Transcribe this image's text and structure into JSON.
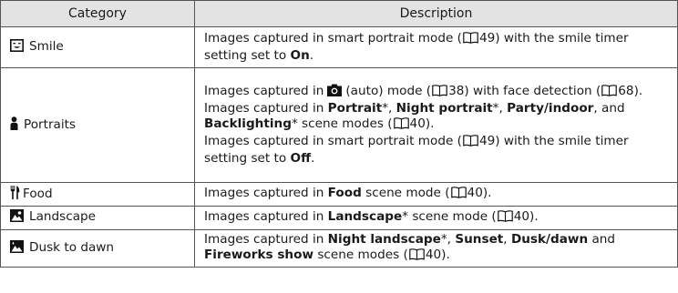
{
  "header": {
    "category": "Category",
    "description": "Description"
  },
  "rows": [
    {
      "icon": "smile-face-icon",
      "category": "Smile",
      "lines": [
        {
          "parts": [
            {
              "t": "Images captured in smart portrait mode ("
            },
            {
              "book": "49"
            },
            {
              "t": ") with the smile timer setting set to "
            },
            {
              "b": "On"
            },
            {
              "t": "."
            }
          ]
        }
      ]
    },
    {
      "icon": "person-icon",
      "category": "Portraits",
      "lines": [
        {
          "parts": [
            {
              "t": "Images captured in"
            },
            {
              "cam": "camera-icon"
            },
            {
              "t": "(auto) mode ("
            },
            {
              "book": "38"
            },
            {
              "t": ") with face detection ("
            },
            {
              "book": "68"
            },
            {
              "t": ")."
            }
          ]
        },
        {
          "parts": [
            {
              "t": "Images captured in "
            },
            {
              "b": "Portrait"
            },
            {
              "t": "*, "
            },
            {
              "b": "Night portrait"
            },
            {
              "t": "*, "
            },
            {
              "b": "Party/indoor"
            },
            {
              "t": ", and "
            },
            {
              "b": "Backlighting"
            },
            {
              "t": "* scene modes ("
            },
            {
              "book": "40"
            },
            {
              "t": ")."
            }
          ]
        },
        {
          "parts": [
            {
              "t": "Images captured in smart portrait mode ("
            },
            {
              "book": "49"
            },
            {
              "t": ") with the smile timer setting set to "
            },
            {
              "b": "Off"
            },
            {
              "t": "."
            }
          ]
        }
      ]
    },
    {
      "icon": "fork-knife-icon",
      "category": "Food",
      "lines": [
        {
          "parts": [
            {
              "t": "Images captured in "
            },
            {
              "b": "Food"
            },
            {
              "t": " scene mode ("
            },
            {
              "book": "40"
            },
            {
              "t": ")."
            }
          ]
        }
      ]
    },
    {
      "icon": "landscape-icon",
      "category": "Landscape",
      "lines": [
        {
          "parts": [
            {
              "t": "Images captured in "
            },
            {
              "b": "Landscape"
            },
            {
              "t": "* scene mode ("
            },
            {
              "book": "40"
            },
            {
              "t": ")."
            }
          ]
        }
      ]
    },
    {
      "icon": "dusk-to-dawn-icon",
      "category": "Dusk to dawn",
      "lines": [
        {
          "parts": [
            {
              "t": "Images captured in "
            },
            {
              "b": "Night landscape"
            },
            {
              "t": "*, "
            },
            {
              "b": "Sunset"
            },
            {
              "t": ", "
            },
            {
              "b": "Dusk/dawn"
            },
            {
              "t": " and "
            },
            {
              "b": "Fireworks show"
            },
            {
              "t": " scene modes ("
            },
            {
              "book": "40"
            },
            {
              "t": ")."
            }
          ]
        }
      ]
    }
  ]
}
